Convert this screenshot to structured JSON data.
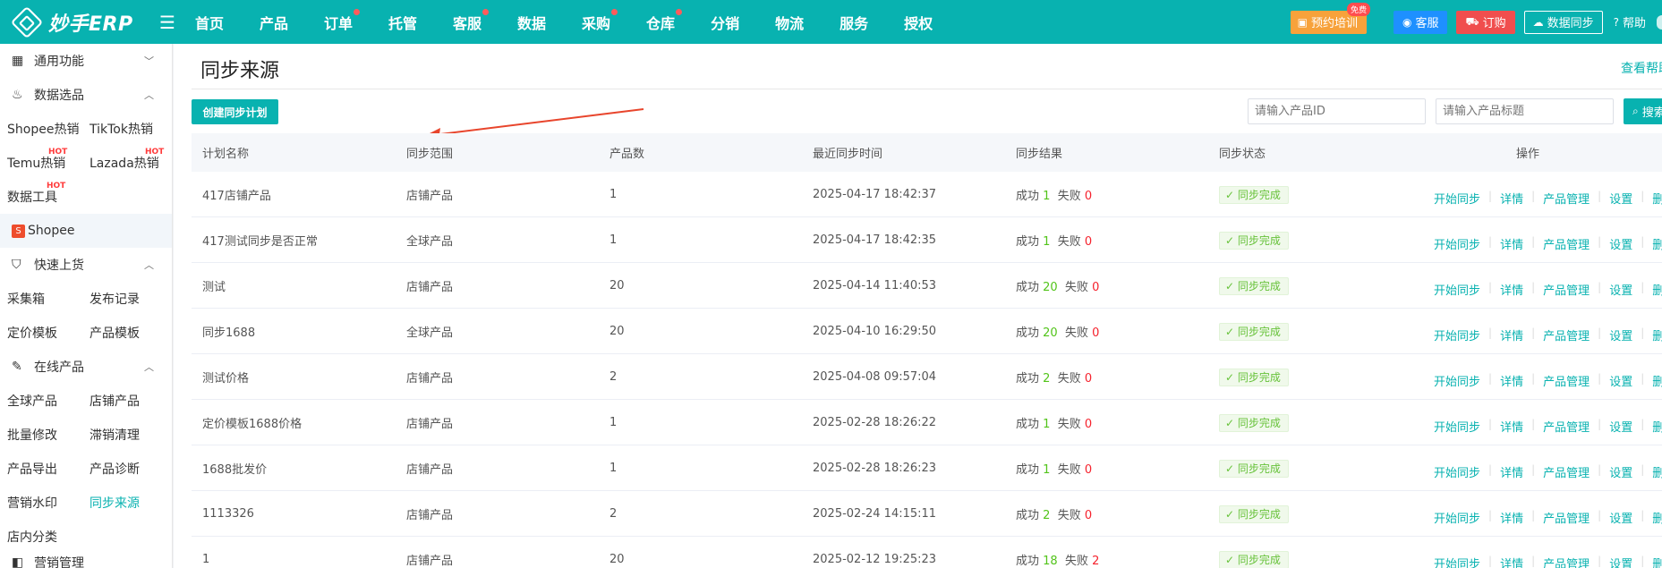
{
  "app": {
    "logo_text": "妙手ERP"
  },
  "nav": [
    {
      "label": "首页",
      "dot": false
    },
    {
      "label": "产品",
      "dot": false
    },
    {
      "label": "订单",
      "dot": true
    },
    {
      "label": "托管",
      "dot": false
    },
    {
      "label": "客服",
      "dot": true
    },
    {
      "label": "数据",
      "dot": false
    },
    {
      "label": "采购",
      "dot": true
    },
    {
      "label": "仓库",
      "dot": true
    },
    {
      "label": "分销",
      "dot": false
    },
    {
      "label": "物流",
      "dot": false
    },
    {
      "label": "服务",
      "dot": false
    },
    {
      "label": "授权",
      "dot": false
    }
  ],
  "topright": {
    "training": "预约培训",
    "free_badge": "免费",
    "service": "客服",
    "order": "订购",
    "sync": "数据同步",
    "help": "帮助"
  },
  "sidebar": {
    "general": "通用功能",
    "data_select": "数据选品",
    "row1": [
      "Shopee热销",
      "TikTok热销"
    ],
    "row2": [
      "Temu热销",
      "Lazada热销"
    ],
    "row3": [
      "数据工具"
    ],
    "hot": "HOT",
    "shopee": "Shopee",
    "quick_upload": "快速上货",
    "row4": [
      "采集箱",
      "发布记录"
    ],
    "row5": [
      "定价模板",
      "产品模板"
    ],
    "online_products": "在线产品",
    "row6": [
      "全球产品",
      "店铺产品"
    ],
    "row7": [
      "批量修改",
      "滞销清理"
    ],
    "row8": [
      "产品导出",
      "产品诊断"
    ],
    "row9": [
      "营销水印",
      "同步来源"
    ],
    "row10": [
      "店内分类"
    ],
    "last_partial": "营销管理"
  },
  "main": {
    "title": "同步来源",
    "help_link": "查看帮助",
    "create_button": "创建同步计划",
    "search_id_placeholder": "请输入产品ID",
    "search_title_placeholder": "请输入产品标题",
    "search_button": "搜索"
  },
  "table": {
    "headers": [
      "计划名称",
      "同步范围",
      "产品数",
      "最近同步时间",
      "同步结果",
      "同步状态",
      "操作"
    ],
    "result_success_label": "成功",
    "result_fail_label": "失败",
    "status_label": "同步完成",
    "ops": [
      "开始同步",
      "详情",
      "产品管理",
      "设置",
      "删除"
    ],
    "rows": [
      {
        "name": "417店铺产品",
        "scope": "店铺产品",
        "count": "1",
        "time": "2025-04-17 18:42:37",
        "success": "1",
        "fail": "0"
      },
      {
        "name": "417测试同步是否正常",
        "scope": "全球产品",
        "count": "1",
        "time": "2025-04-17 18:42:35",
        "success": "1",
        "fail": "0"
      },
      {
        "name": "测试",
        "scope": "店铺产品",
        "count": "20",
        "time": "2025-04-14 11:40:53",
        "success": "20",
        "fail": "0"
      },
      {
        "name": "同步1688",
        "scope": "全球产品",
        "count": "20",
        "time": "2025-04-10 16:29:50",
        "success": "20",
        "fail": "0"
      },
      {
        "name": "测试价格",
        "scope": "店铺产品",
        "count": "2",
        "time": "2025-04-08 09:57:04",
        "success": "2",
        "fail": "0"
      },
      {
        "name": "定价模板1688价格",
        "scope": "店铺产品",
        "count": "1",
        "time": "2025-02-28 18:26:22",
        "success": "1",
        "fail": "0"
      },
      {
        "name": "1688批发价",
        "scope": "店铺产品",
        "count": "1",
        "time": "2025-02-28 18:26:23",
        "success": "1",
        "fail": "0"
      },
      {
        "name": "1113326",
        "scope": "店铺产品",
        "count": "2",
        "time": "2025-02-24 14:15:11",
        "success": "2",
        "fail": "0"
      },
      {
        "name": "1",
        "scope": "店铺产品",
        "count": "20",
        "time": "2025-02-12 19:25:23",
        "success": "18",
        "fail": "2"
      }
    ]
  }
}
